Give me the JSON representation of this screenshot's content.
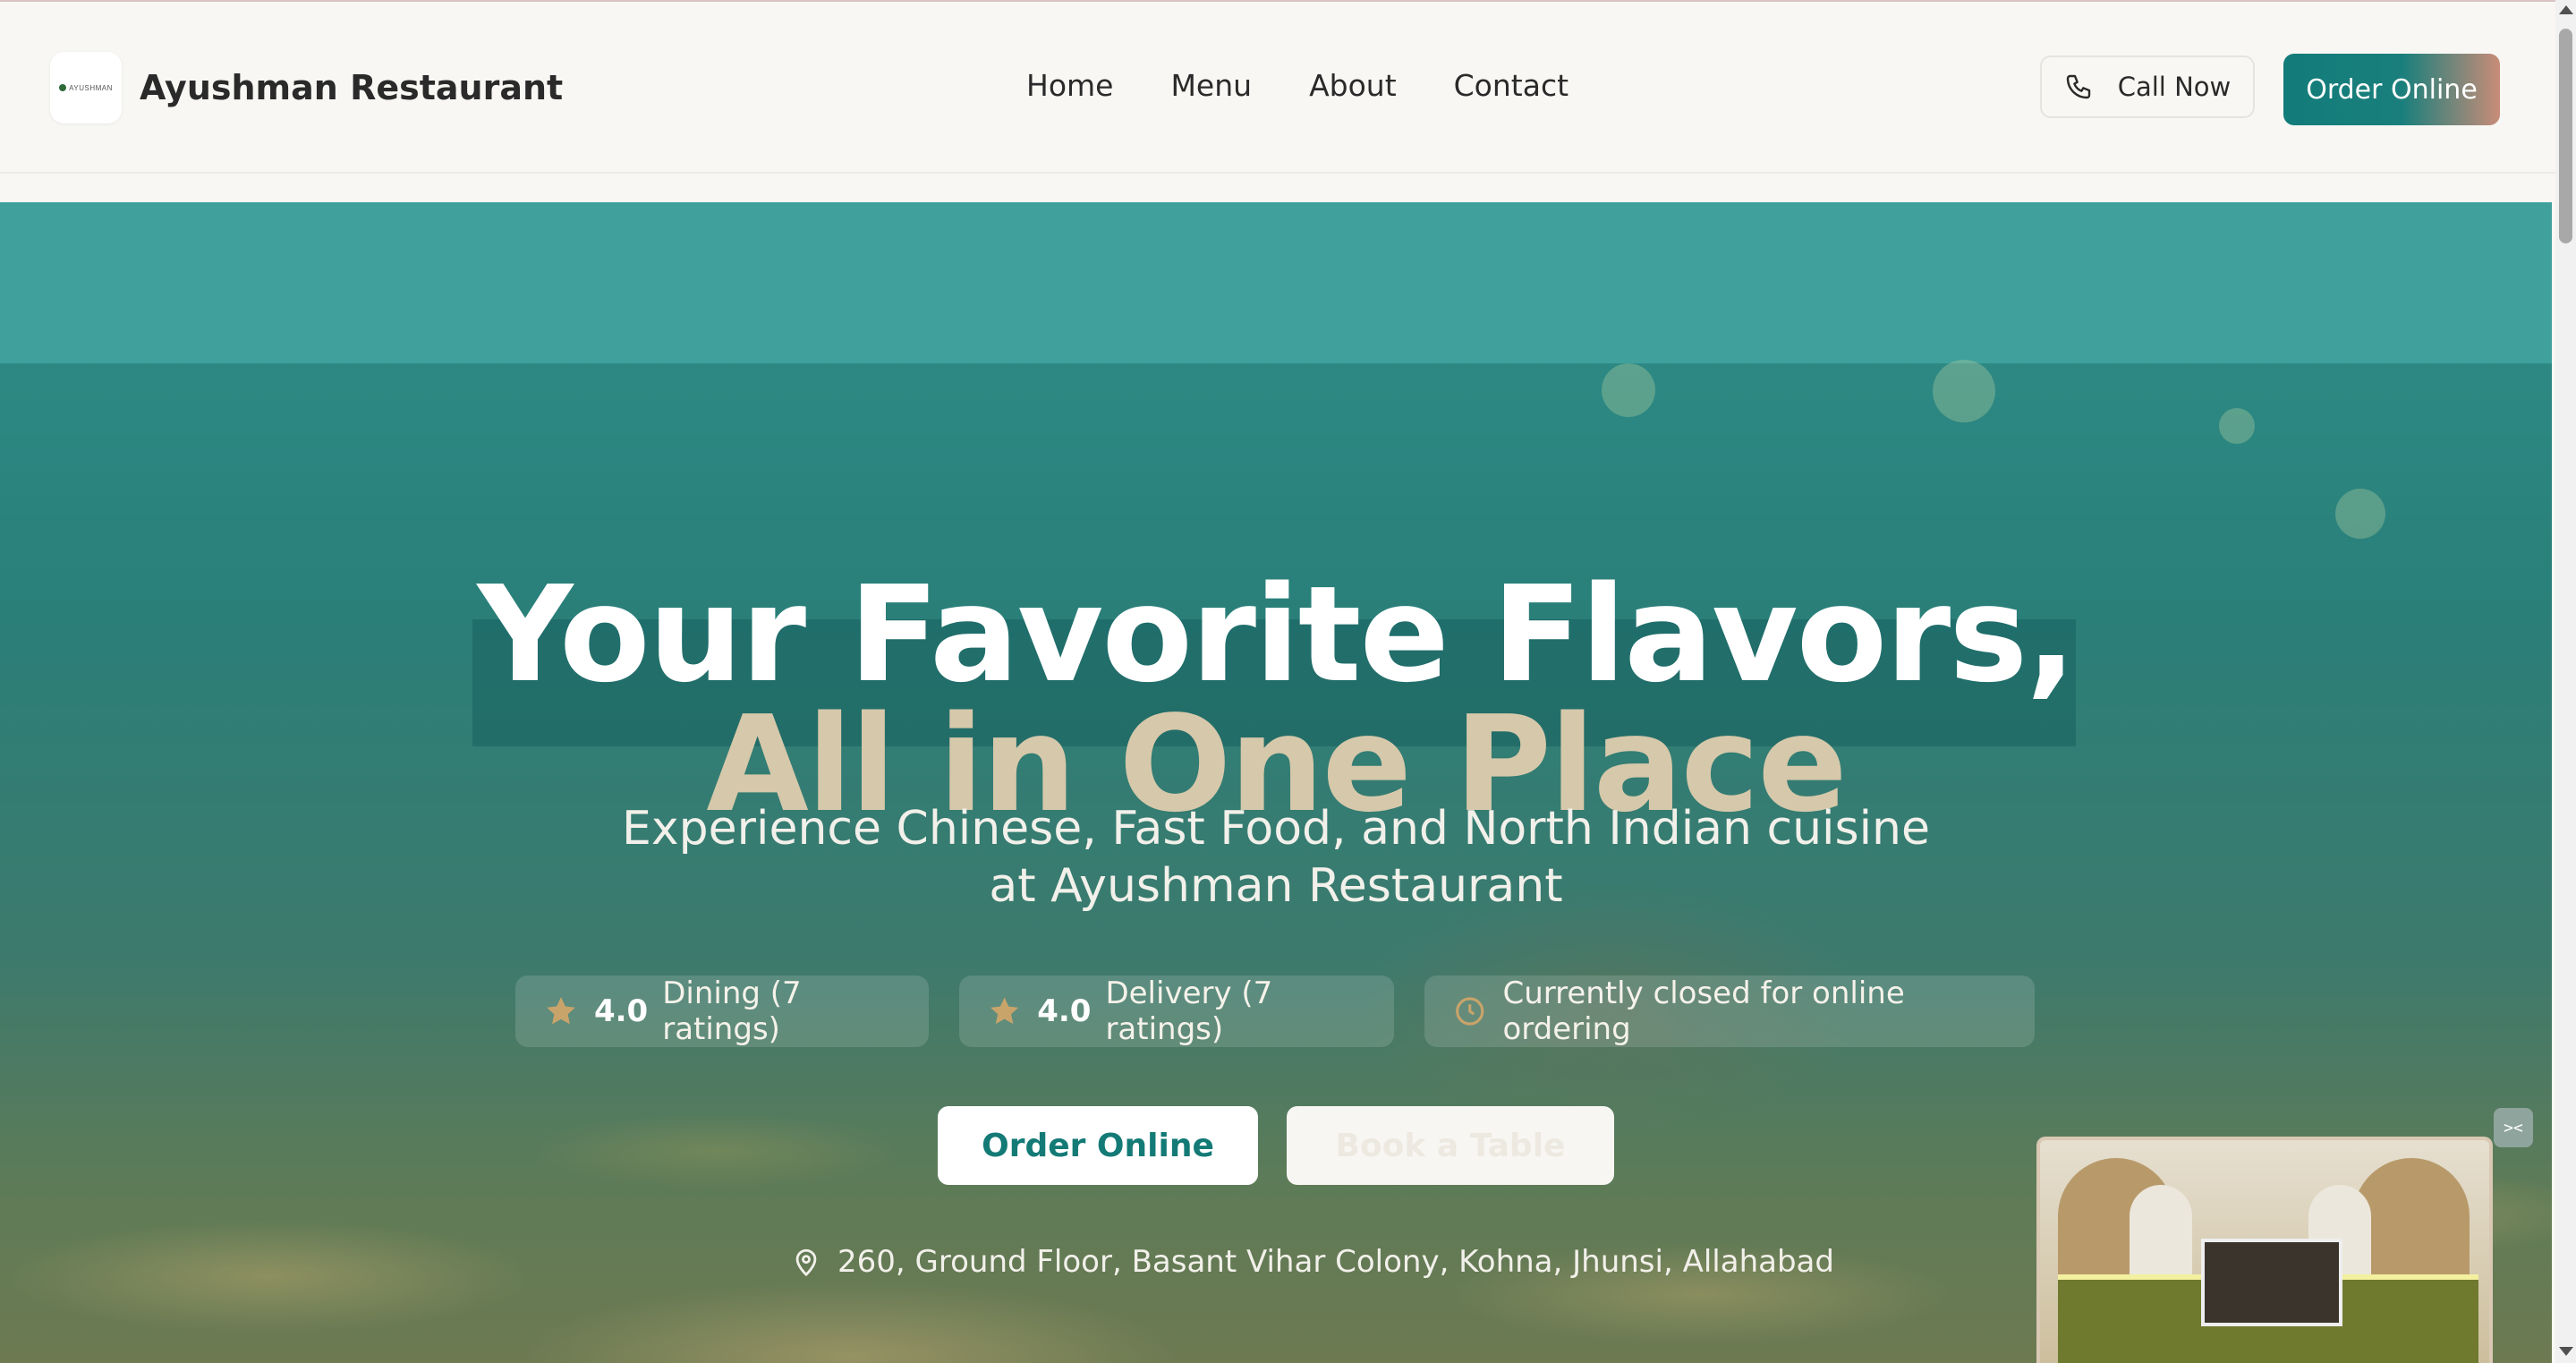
{
  "header": {
    "brand_name": "Ayushman Restaurant",
    "logo_text": "AYUSHMAN",
    "nav": [
      "Home",
      "Menu",
      "About",
      "Contact"
    ],
    "call_label": "Call Now",
    "order_label": "Order Online"
  },
  "hero": {
    "title_line1": "Your Favorite Flavors,",
    "title_line2": "All in One Place",
    "subtitle_line1": "Experience Chinese, Fast Food, and North Indian cuisine",
    "subtitle_line2": "at Ayushman Restaurant",
    "ratings": [
      {
        "rating": "4.0",
        "label": "Dining (7 ratings)"
      },
      {
        "rating": "4.0",
        "label": "Delivery (7 ratings)"
      }
    ],
    "status": "Currently closed for online ordering",
    "order_button": "Order Online",
    "book_button": "Book a Table",
    "address": "260, Ground Floor, Basant Vihar Colony, Kohna, Jhunsi, Allahabad"
  },
  "video": {
    "toggle_label": "><"
  },
  "colors": {
    "brand_teal": "#137a76",
    "accent_beige": "#d6c8aa",
    "star_gold": "#c9a46a",
    "header_bg": "#f8f7f4"
  },
  "icons": {
    "call": "phone-icon",
    "star": "star-icon",
    "status": "clock-icon",
    "address": "map-pin-icon"
  }
}
